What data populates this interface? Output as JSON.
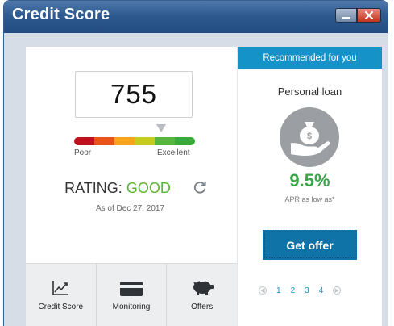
{
  "window": {
    "title": "Credit Score"
  },
  "score": {
    "value": "755",
    "gauge_position": 0.72,
    "gauge_colors": [
      "#c0111e",
      "#e8541a",
      "#f7a41d",
      "#c6cc1f",
      "#57b43c",
      "#39a93a"
    ],
    "scale_low_label": "Poor",
    "scale_high_label": "Excellent",
    "rating_label": "RATING:",
    "rating_value": "GOOD",
    "as_of": "As of Dec 27, 2017"
  },
  "nav": {
    "items": [
      {
        "label": "Credit Score",
        "icon": "trend-chart-icon"
      },
      {
        "label": "Monitoring",
        "icon": "credit-card-icon"
      },
      {
        "label": "Offers",
        "icon": "piggy-bank-icon"
      }
    ]
  },
  "recommendation": {
    "header": "Recommended for you",
    "product": "Personal loan",
    "icon": "money-bag-hand-icon",
    "apr": "9.5%",
    "apr_caption": "APR as low as*",
    "button_label": "Get offer",
    "pages": [
      "1",
      "2",
      "3",
      "4"
    ]
  },
  "colors": {
    "title_bar": "#2e5a90",
    "accent_blue": "#1593c9",
    "button_blue": "#0f73a7",
    "good_green": "#5ab534",
    "apr_green": "#3aa64a"
  }
}
